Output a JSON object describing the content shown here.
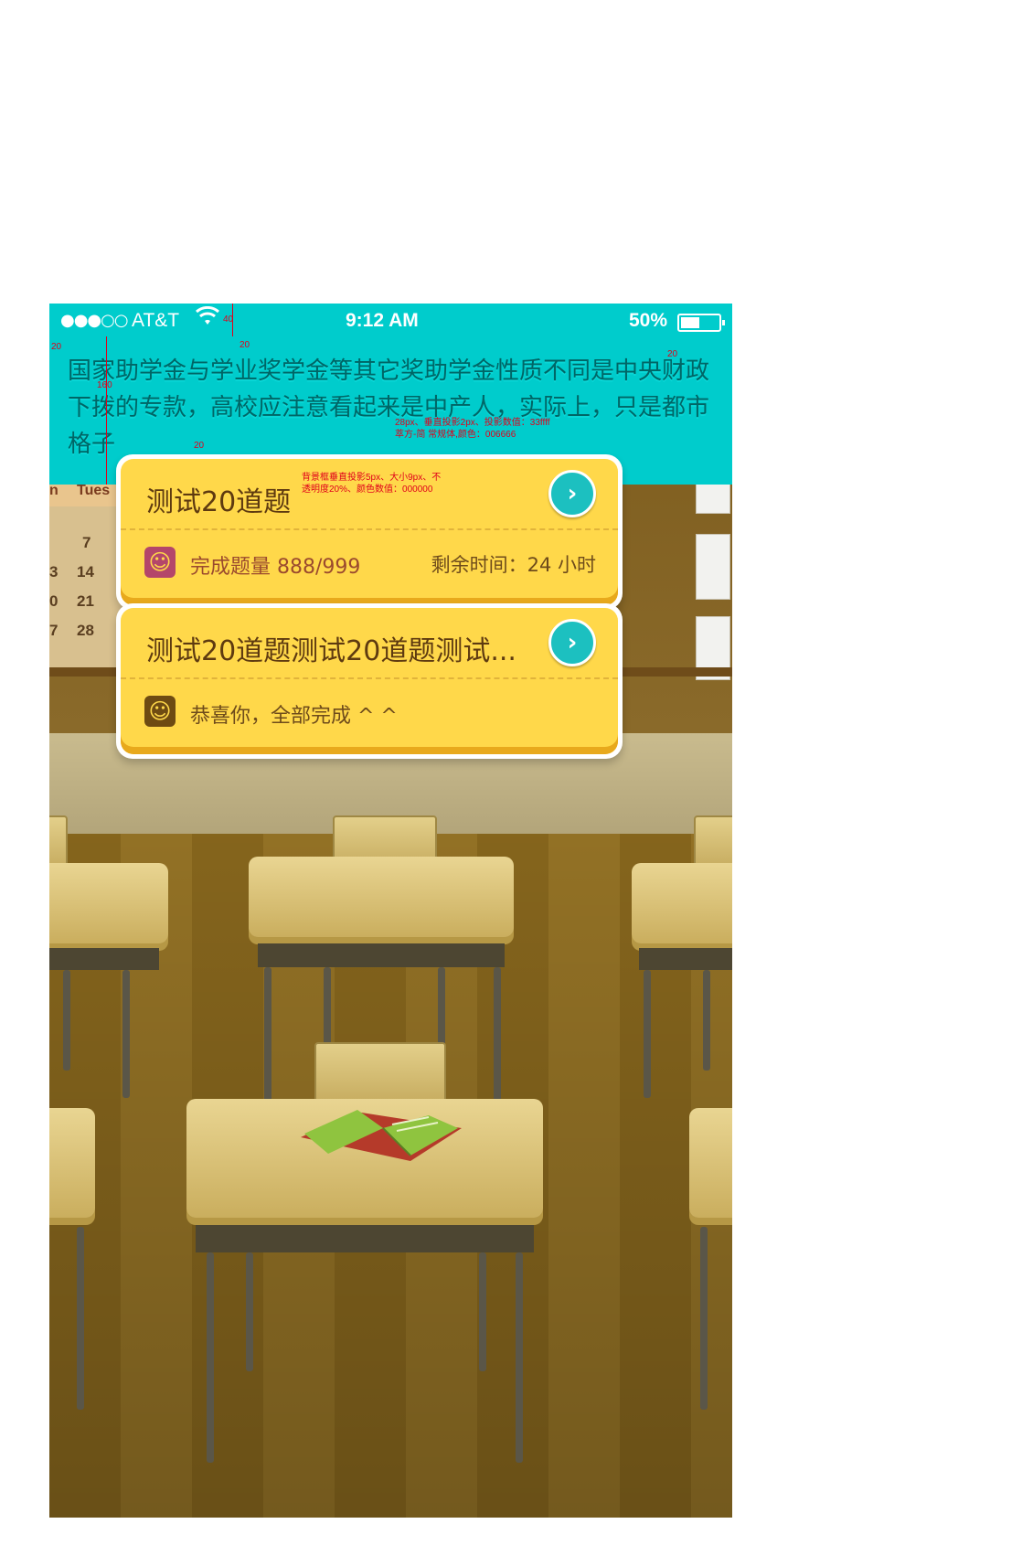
{
  "status_bar": {
    "signal": "●●●○○",
    "carrier": "AT&T",
    "wifi_icon": "wifi-icon",
    "time": "9:12 AM",
    "battery_percent": "50%",
    "battery_level": 0.5
  },
  "notice": {
    "text": "国家助学金与学业奖学金等其它奖助学金性质不同是中央财政下拨的专款，高校应注意看起来是中产人，实际上，只是都市格子"
  },
  "annotations": {
    "top_gap": "40",
    "text_gap": "20",
    "left_margin": "20",
    "right_margin": "20",
    "height": "160",
    "bottom_gap": "20",
    "font_note_line1": "28px、垂直投影2px、投影数值：33ffff",
    "font_note_line2": "萃方-简 常规体,颜色：006666",
    "shadow_note_line1": "背景框垂直投影5px、大小9px、不",
    "shadow_note_line2": "透明度20%、颜色数值：000000"
  },
  "background": {
    "calendar_header": "Tues",
    "calendar_numbers": [
      "7",
      "14",
      "21",
      "28"
    ],
    "calendar_side": [
      "n",
      "3",
      "0",
      "7"
    ]
  },
  "cards": [
    {
      "title": "测试20道题",
      "go_icon": "chevron-right-icon",
      "face_icon": "smile-icon",
      "progress_text": "完成题量 888/999",
      "remaining_text": "剩余时间：24 小时",
      "face_color": "#b4466a"
    },
    {
      "title": "测试20道题测试20道题测试...",
      "go_icon": "chevron-right-icon",
      "face_icon": "smile-icon",
      "progress_text": "恭喜你，全部完成 ^ ^",
      "remaining_text": "",
      "face_color": "#6e4b12"
    }
  ],
  "colors": {
    "header_bg": "#00cccc",
    "notice_text": "#006666",
    "card_bg": "#ffd84a",
    "go_button": "#1cc0c0"
  }
}
